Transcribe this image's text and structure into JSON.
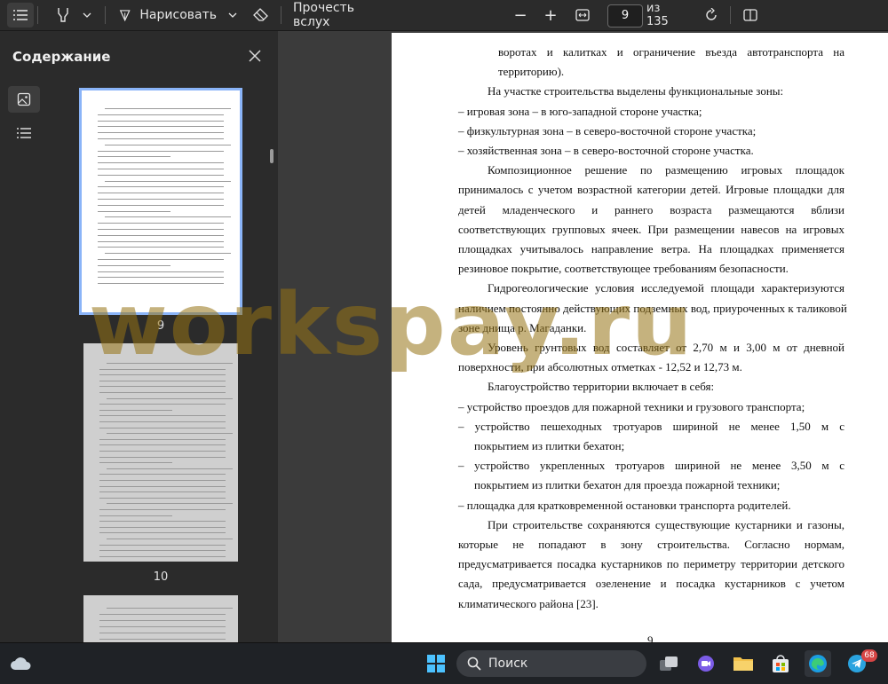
{
  "toolbar": {
    "draw_label": "Нарисовать",
    "read_aloud_label": "Прочесть вслух",
    "page_current": "9",
    "page_total": "из 135"
  },
  "sidebar": {
    "title": "Содержание",
    "thumbnail_labels": [
      "9",
      "10"
    ]
  },
  "document": {
    "page_number": "9",
    "lines": [
      "воротах и калитках и ограничение въезда автотранспорта на",
      "территорию).",
      "На участке строительства выделены функциональные зоны:",
      "–  игровая зона – в юго-западной стороне участка;",
      "–  физкультурная зона – в северо-восточной стороне участка;",
      "–  хозяйственная зона – в северо-восточной стороне участка.",
      "Композиционное решение по размещению игровых площадок",
      "принималось с учетом возрастной категории детей. Игровые площадки для",
      "детей младенческого и раннего возраста размещаются вблизи",
      "соответствующих групповых ячеек. При размещении навесов на игровых",
      "площадках учитывалось направление ветра. На площадках применяется",
      "резиновое покрытие, соответствующее требованиям безопасности.",
      "Гидрогеологические условия исследуемой площади характеризуются",
      "наличием постоянно действующих подземных вод, приуроченных к таликовой",
      "зоне днища р. Магаданки.",
      "Уровень грунтовых вод составляет от 2,70 м и 3,00 м от дневной",
      "поверхности, при абсолютных отметках - 12,52 и 12,73 м.",
      "Благоустройство территории включает в себя:",
      "–  устройство проездов для пожарной техники и грузового транспорта;",
      "–  устройство пешеходных тротуаров шириной не менее 1,50 м с",
      "покрытием из плитки бехатон;",
      "–  устройство укрепленных тротуаров шириной не менее 3,50 м с",
      "покрытием из плитки бехатон для проезда пожарной техники;",
      "–  площадка для кратковременной остановки транспорта родителей.",
      "При строительстве сохраняются существующие кустарники и газоны,",
      "которые не попадают в зону строительства. Согласно нормам,",
      "предусматривается посадка кустарников по периметру территории детского",
      "сада, предусматривается озеленение и посадка кустарников с учетом",
      "климатического района [23]."
    ]
  },
  "watermark": "workspay.ru",
  "taskbar": {
    "search_label": "Поиск",
    "telegram_badge": "68"
  },
  "colors": {
    "accent": "#8ab4f8",
    "toolbar_bg": "#2b2b2b",
    "viewer_bg": "#3b3b3b",
    "taskbar_bg": "#1f2226",
    "watermark": "#96731a"
  }
}
